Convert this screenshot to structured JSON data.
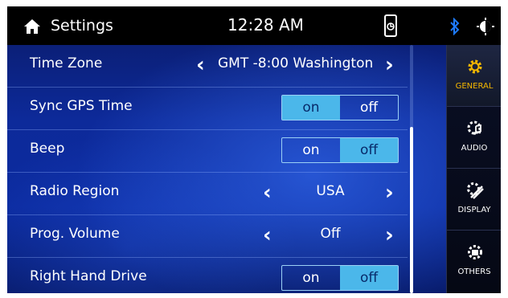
{
  "header": {
    "title": "Settings",
    "clock": "12:28 AM",
    "icons": [
      "home-icon",
      "phone-link-icon",
      "bluetooth-icon",
      "brightness-icon"
    ]
  },
  "settings": {
    "time_zone": {
      "label": "Time Zone",
      "value": "GMT -8:00 Washington"
    },
    "sync_gps_time": {
      "label": "Sync GPS Time",
      "on": "on",
      "off": "off",
      "selected": "on"
    },
    "beep": {
      "label": "Beep",
      "on": "on",
      "off": "off",
      "selected": "off"
    },
    "radio_region": {
      "label": "Radio Region",
      "value": "USA"
    },
    "prog_volume": {
      "label": "Prog. Volume",
      "value": "Off"
    },
    "right_hand_drive": {
      "label": "Right Hand Drive",
      "on": "on",
      "off": "off",
      "selected": "off"
    }
  },
  "sidebar": {
    "items": [
      {
        "label": "GENERAL",
        "icon": "gear-icon",
        "active": true
      },
      {
        "label": "AUDIO",
        "icon": "gear-music-icon",
        "active": false
      },
      {
        "label": "DISPLAY",
        "icon": "gear-display-icon",
        "active": false
      },
      {
        "label": "OTHERS",
        "icon": "gear-others-icon",
        "active": false
      }
    ]
  },
  "colors": {
    "accent": "#4bb7ea",
    "active_tab": "#f5b800",
    "background": "#0d2a9a"
  }
}
